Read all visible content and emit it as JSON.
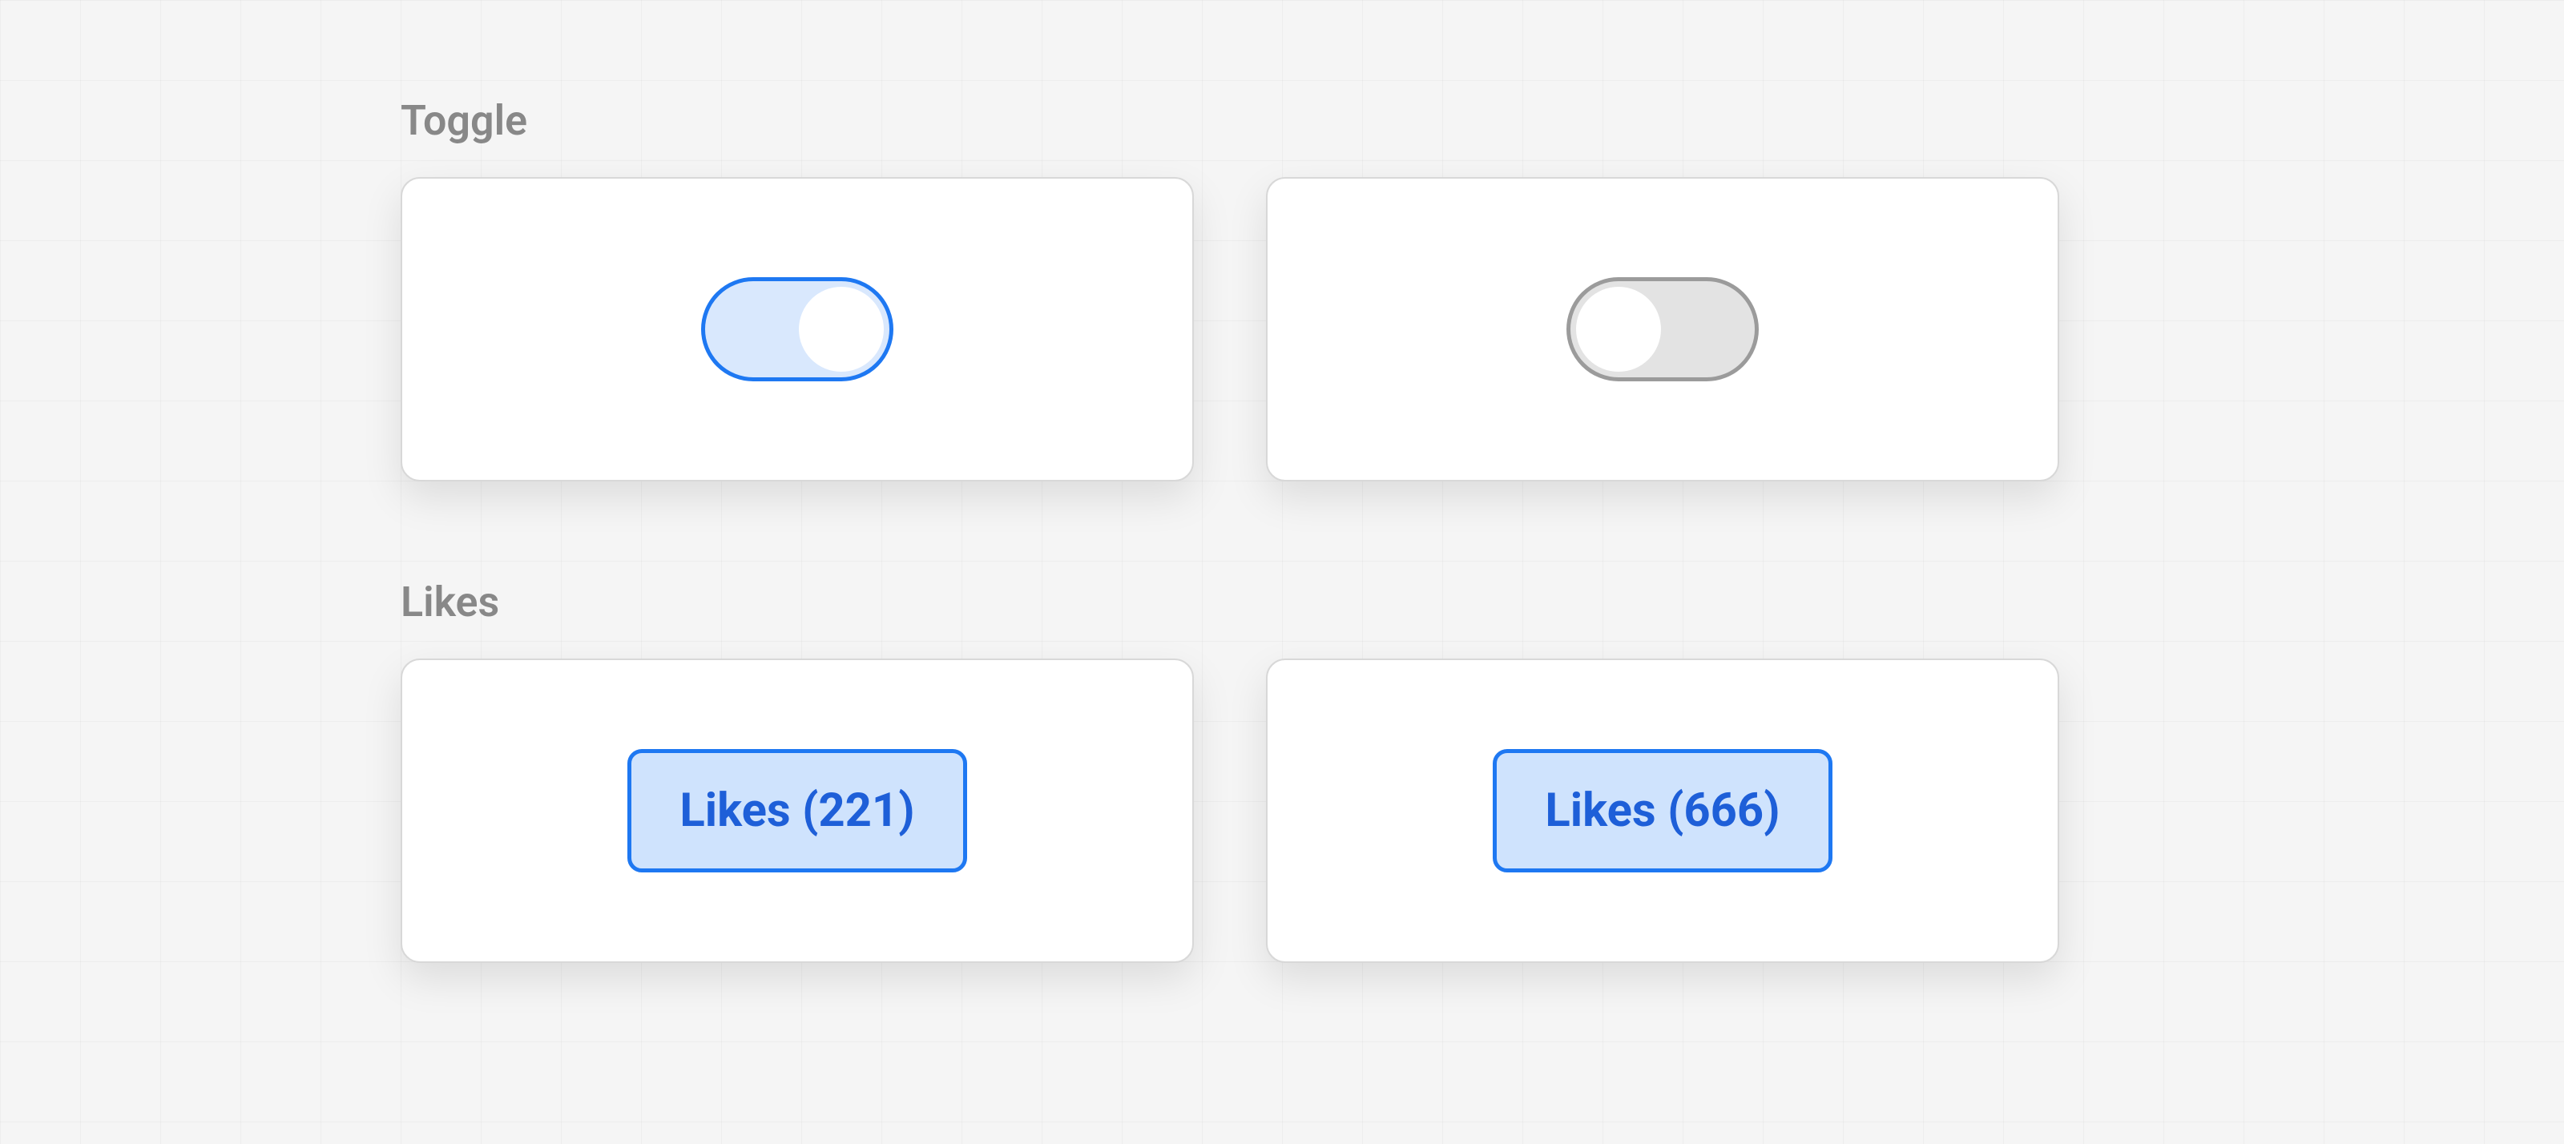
{
  "sections": {
    "toggle": {
      "label": "Toggle",
      "items": [
        {
          "state": "on"
        },
        {
          "state": "off"
        }
      ]
    },
    "likes": {
      "label": "Likes",
      "items": [
        {
          "label": "Likes (221)",
          "count": 221
        },
        {
          "label": "Likes (666)",
          "count": 666
        }
      ]
    }
  },
  "colors": {
    "accent": "#1e78f2",
    "accent_fill": "#cfe3fd",
    "toggle_on_fill": "#d9e8fd",
    "toggle_off_fill": "#e3e3e3",
    "toggle_off_border": "#9b9b9b",
    "label_gray": "#888888"
  }
}
